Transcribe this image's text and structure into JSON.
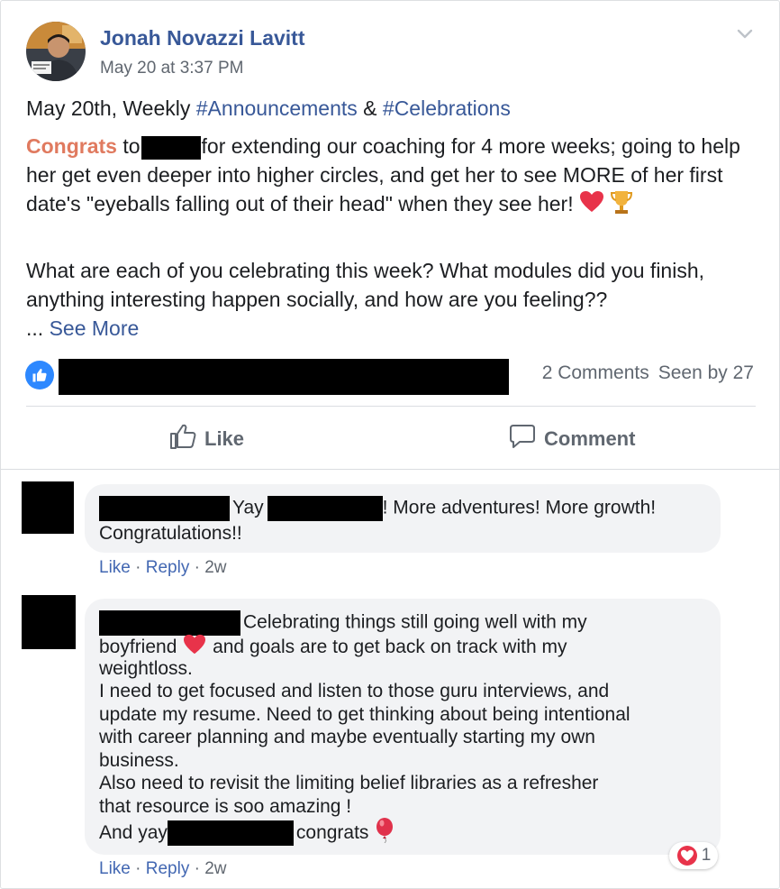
{
  "post": {
    "author": "Jonah Novazzi Lavitt",
    "timestamp": "May 20 at 3:37 PM",
    "line1_prefix": "May 20th, Weekly ",
    "hashtag1": "#Announcements",
    "amp": " & ",
    "hashtag2": "#Celebrations",
    "congrats": "Congrats",
    "para2_to": " to",
    "para2_rest": "for extending our coaching for 4 more weeks; going to help her get even deeper into higher circles, and get her to see MORE of her first date's \"eyeballs falling out of their head\" when they see her! ",
    "para3": "What are each of you celebrating this week? What modules did you finish, anything interesting happen socially, and how are you feeling??",
    "ellipsis": "... ",
    "see_more": "See More"
  },
  "stats": {
    "comments": "2 Comments",
    "seen": "Seen by 27"
  },
  "actions": {
    "like": "Like",
    "comment": "Comment"
  },
  "comments": [
    {
      "text_a": "Yay",
      "text_b": "! More adventures! More growth!",
      "text_c": "Congratulations!!",
      "like": "Like",
      "sep": " · ",
      "reply": "Reply",
      "time": "2w"
    },
    {
      "text_a": "Celebrating things still going well with my",
      "text_b": "boyfriend",
      "text_c": "and goals are to get back on track with my",
      "text_d": "weightloss.",
      "text_e": "I need to get focused and listen to those guru interviews, and",
      "text_f": "update my resume. Need to get thinking about being intentional",
      "text_g": "with career planning and maybe eventually starting my own",
      "text_h": "business.",
      "text_i": "Also need to revisit the limiting belief libraries as a refresher",
      "text_j": "that resource is soo amazing !",
      "text_k": "And yay",
      "text_l": "congrats",
      "reaction_count": "1",
      "like": "Like",
      "sep": " · ",
      "reply": "Reply",
      "time": "2w"
    }
  ],
  "colors": {
    "link": "#385898",
    "congrats": "#e07a5f",
    "like_blue": "#2d88ff",
    "heart": "#e8334a"
  },
  "icons": [
    "chevron-down-icon",
    "like-reaction-icon",
    "thumbs-up-icon",
    "comment-icon",
    "heart-emoji-icon",
    "trophy-emoji-icon",
    "balloon-emoji-icon",
    "heart-reaction-icon"
  ]
}
